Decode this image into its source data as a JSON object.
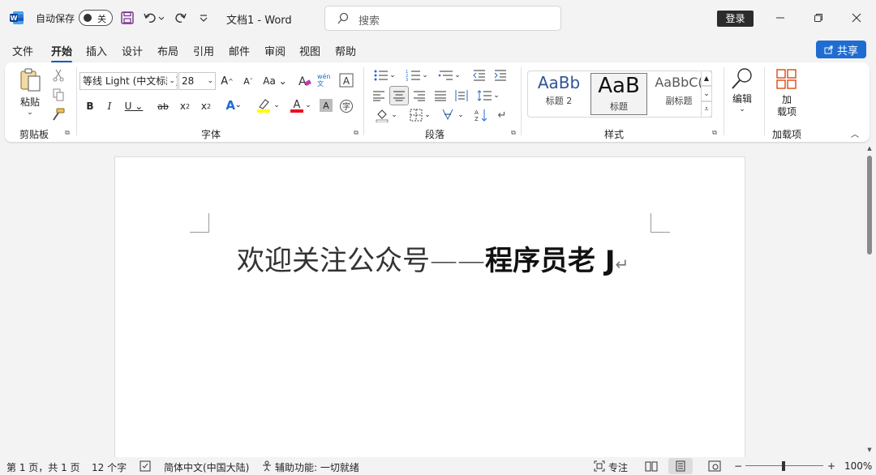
{
  "titlebar": {
    "autosave_label": "自动保存",
    "autosave_state": "关",
    "doc_title": "文档1  -  Word",
    "search_placeholder": "搜索",
    "login_label": "登录"
  },
  "tabs": [
    "文件",
    "开始",
    "插入",
    "设计",
    "布局",
    "引用",
    "邮件",
    "审阅",
    "视图",
    "帮助"
  ],
  "active_tab": "开始",
  "share_label": "共享",
  "ribbon": {
    "clipboard": {
      "paste_label": "粘贴",
      "group_label": "剪贴板"
    },
    "font": {
      "font_name": "等线 Light (中文标题)",
      "font_size": "28",
      "group_label": "字体",
      "phonetic": "wén 文"
    },
    "paragraph": {
      "group_label": "段落"
    },
    "styles": {
      "group_label": "样式",
      "items": [
        {
          "sample": "AaBb",
          "name": "标题 2"
        },
        {
          "sample": "AaB",
          "name": "标题"
        },
        {
          "sample": "AaBbC(",
          "name": "副标题"
        }
      ]
    },
    "editing": {
      "label": "编辑"
    },
    "addins": {
      "button_label_1": "加",
      "button_label_2": "载项",
      "group_label": "加载项"
    }
  },
  "document": {
    "text_light": "欢迎关注公众号——",
    "text_bold": "程序员老 J",
    "para_mark": "↵"
  },
  "status": {
    "page": "第 1 页，共 1 页",
    "words": "12 个字",
    "language": "简体中文(中国大陆)",
    "accessibility": "辅助功能: 一切就绪",
    "focus": "专注",
    "zoom": "100%"
  },
  "colors": {
    "accent": "#185abd",
    "share_bg": "#1f6cd2",
    "highlight": "#ffff00",
    "font_color": "#e81123"
  }
}
